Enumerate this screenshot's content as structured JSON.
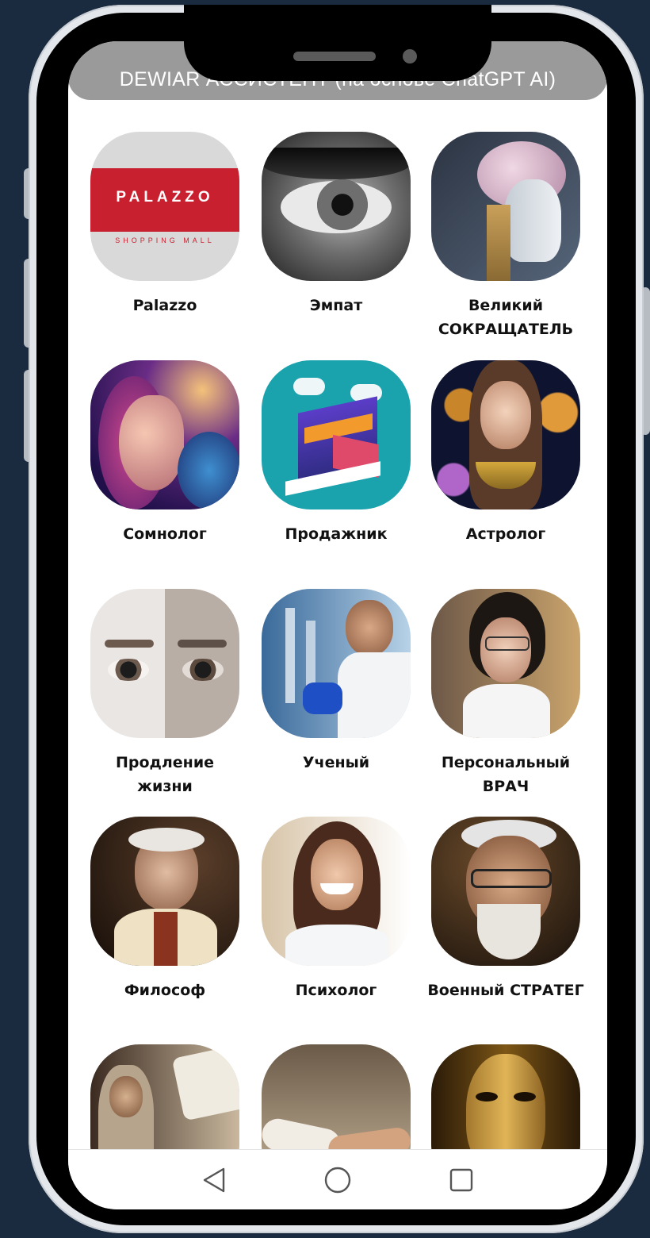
{
  "app": {
    "title": "DEWIAR АССИСТЕНТ (на основе ChatGPT AI)"
  },
  "assistants": [
    {
      "label": "Palazzo",
      "icon": "palazzo-logo",
      "logo_text": "PALAZZO",
      "logo_sub": "SHOPPING MALL"
    },
    {
      "label": "Эмпат",
      "icon": "eye-portrait"
    },
    {
      "label": "Великий СОКРАЩАТЕЛЬ",
      "icon": "robot-head-brain"
    },
    {
      "label": "Сомнолог",
      "icon": "dreaming-woman"
    },
    {
      "label": "Продажник",
      "icon": "isometric-store"
    },
    {
      "label": "Астролог",
      "icon": "astrologer-woman"
    },
    {
      "label": "Продление жизни",
      "icon": "young-old-face"
    },
    {
      "label": "Ученый",
      "icon": "scientist-lab"
    },
    {
      "label": "Персональный ВРАЧ",
      "icon": "doctor-woman"
    },
    {
      "label": "Философ",
      "icon": "old-philosopher"
    },
    {
      "label": "Психолог",
      "icon": "smiling-psychologist"
    },
    {
      "label": "Военный СТРАТЕГ",
      "icon": "old-strategist"
    },
    {
      "label": "",
      "icon": "preacher-book"
    },
    {
      "label": "",
      "icon": "helping-hands"
    },
    {
      "label": "",
      "icon": "golden-mask"
    }
  ],
  "nav": {
    "back": "back-triangle-icon",
    "home": "home-circle-icon",
    "recents": "recents-square-icon"
  },
  "colors": {
    "background": "#1a2b40",
    "title_bar": "#9a9a9a",
    "palazzo_red": "#c8202f"
  }
}
